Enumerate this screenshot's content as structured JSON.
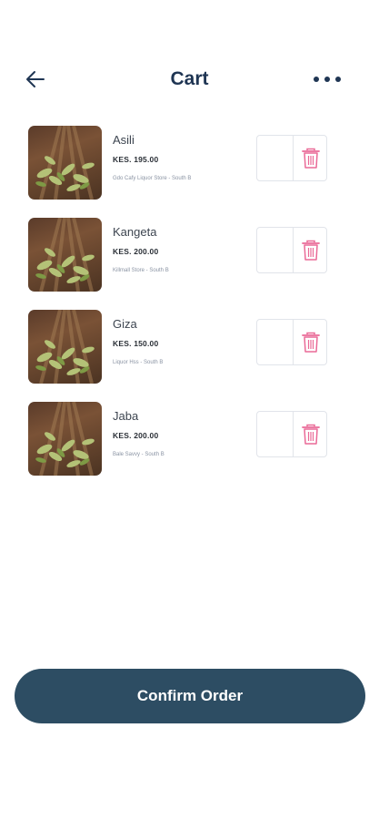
{
  "header": {
    "title": "Cart"
  },
  "items": [
    {
      "name": "Asili",
      "price": "KES. 195.00",
      "store": "Gdo Cafy Liquor Store - South B"
    },
    {
      "name": "Kangeta",
      "price": "KES. 200.00",
      "store": "Killmall Store - South B"
    },
    {
      "name": "Giza",
      "price": "KES. 150.00",
      "store": "Liquor Hss - South B"
    },
    {
      "name": "Jaba",
      "price": "KES. 200.00",
      "store": "Bale Savvy - South B"
    }
  ],
  "confirm_label": "Confirm Order",
  "colors": {
    "accent": "#2d4d63",
    "title": "#1f3553",
    "trash": "#ea6a97"
  },
  "icons": {
    "back": "arrow-left-icon",
    "more": "more-horizontal-icon",
    "delete": "trash-icon"
  }
}
